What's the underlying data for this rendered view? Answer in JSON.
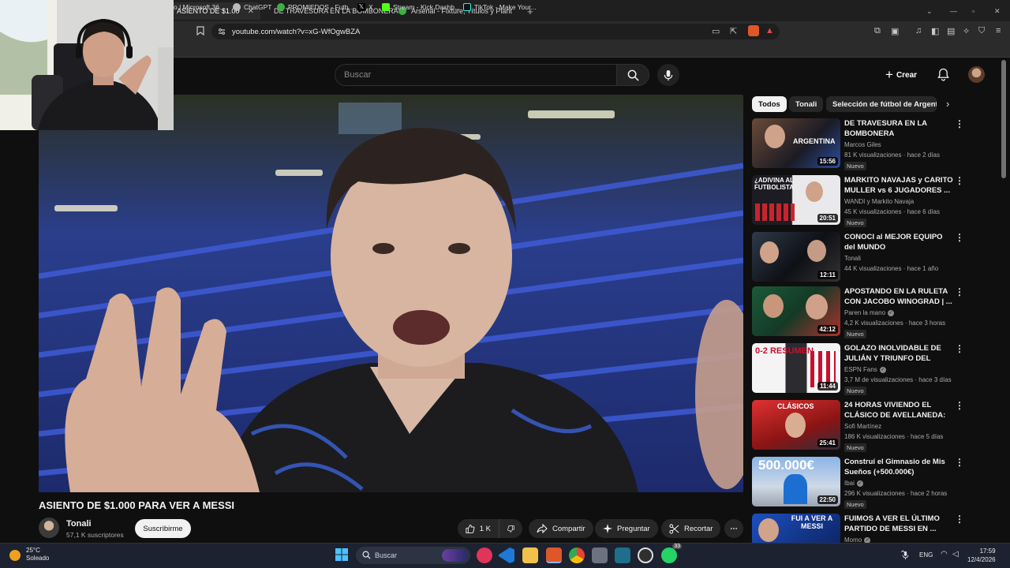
{
  "browser": {
    "tabs": [
      {
        "label": "ASIENTO DE $1.000 PARA VE",
        "active": true
      },
      {
        "label": "DE TRAVESURA EN LA BOMBONERA",
        "active": false
      },
      {
        "label": "Arsenal - Fixture, Títulos y Plantel en",
        "active": false
      }
    ],
    "url": "youtube.com/watch?v=xG-WfOgwBZA",
    "bookmarks": [
      "o | Microsoft 36...",
      "ChatGPT",
      "PROMIEDOS - Futb...",
      "X",
      "Stream - Kick Dashb...",
      "TikTok - Make Your..."
    ]
  },
  "header": {
    "search_placeholder": "Buscar",
    "create_label": "Crear"
  },
  "chips": [
    "Todos",
    "Tonali",
    "Selección de fútbol de Argentina"
  ],
  "video": {
    "title": "ASIENTO DE $1.000 PARA VER A MESSI",
    "channel": "Tonali",
    "subscribers": "57,1 K suscriptores",
    "subscribe_label": "Suscribirme",
    "likes": "1 K",
    "share_label": "Compartir",
    "ask_label": "Preguntar",
    "clip_label": "Recortar"
  },
  "recommendations": [
    {
      "title": "DE TRAVESURA EN LA BOMBONERA",
      "channel": "Marcos Giles",
      "verified": false,
      "meta": "81 K visualizaciones · hace 2 días",
      "badge": "Nuevo",
      "duration": "15:56",
      "thumb_text": "ARGENTINA"
    },
    {
      "title": "MARKITO NAVAJAS y CARITO MULLER vs 6 JUGADORES ...",
      "channel": "WANDI y Markito Navaja",
      "verified": false,
      "meta": "45 K visualizaciones · hace 6 días",
      "badge": "Nuevo",
      "duration": "20:51",
      "thumb_text": "¿ADIVINA AL FUTBOLISTA"
    },
    {
      "title": "CONOCI al MEJOR EQUIPO del MUNDO",
      "channel": "Tonali",
      "verified": false,
      "meta": "44 K visualizaciones · hace 1 año",
      "badge": "",
      "duration": "12:11",
      "thumb_text": ""
    },
    {
      "title": "APOSTANDO EN LA RULETA CON JACOBO WINOGRAD | ...",
      "channel": "Paren la mano",
      "verified": true,
      "meta": "4,2 K visualizaciones · hace 3 horas",
      "badge": "Nuevo",
      "duration": "42:12",
      "thumb_text": ""
    },
    {
      "title": "GOLAZO INOLVIDABLE DE JULIÁN Y TRIUNFO DEL ALETI...",
      "channel": "ESPN Fans",
      "verified": true,
      "meta": "3,7 M de visualizaciones · hace 3 días",
      "badge": "Nuevo",
      "duration": "11:44",
      "thumb_text": "0-2 RESUMEN"
    },
    {
      "title": "24 HORAS VIVIENDO EL CLÁSICO DE AVELLANEDA: DE...",
      "channel": "Sofi Martínez",
      "verified": false,
      "meta": "186 K visualizaciones · hace 5 días",
      "badge": "Nuevo",
      "duration": "25:41",
      "thumb_text": "CLÁSICOS"
    },
    {
      "title": "Construí el Gimnasio de Mis Sueños (+500.000€)",
      "channel": "Ibai",
      "verified": true,
      "meta": "296 K visualizaciones · hace 2 horas",
      "badge": "Nuevo",
      "duration": "22:50",
      "thumb_text": "500.000€"
    },
    {
      "title": "FUIMOS A VER EL ÚLTIMO PARTIDO DE MESSI EN ...",
      "channel": "Momo",
      "verified": true,
      "meta": "",
      "badge": "",
      "duration": "",
      "thumb_text": "FUI A VER A MESSI"
    }
  ],
  "taskbar": {
    "weather_temp": "25°C",
    "weather_desc": "Soleado",
    "search_label": "Buscar",
    "lang": "ENG",
    "time": "17:59",
    "date": "12/4/2026",
    "whatsapp_badge": "33"
  },
  "colors": {
    "youtube_red": "#ff0000",
    "background": "#0f0f0f",
    "chip_active": "#f1f1f1"
  }
}
